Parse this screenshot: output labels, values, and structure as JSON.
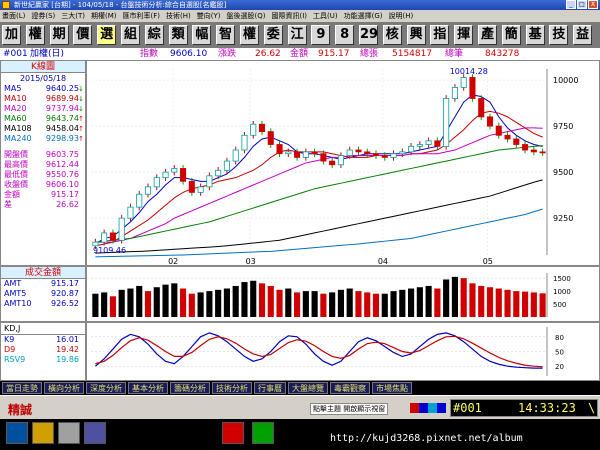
{
  "titlebar": {
    "title": "新世紀贏家 [台期] - 104/05/18 - 台盤技術分析:綜合自選股[名鑑股]",
    "buttons": [
      "_",
      "□",
      "X"
    ]
  },
  "menubar": {
    "items": [
      "畫面(L)",
      "證券(S)",
      "三大(T)",
      "期權(M)",
      "匯市利率(F)",
      "技術(H)",
      "雙向(Y)",
      "盤後選股(Q)",
      "國際資訊(I)",
      "工具(U)",
      "功能選擇(G)",
      "說明(H)"
    ]
  },
  "toolbar": {
    "buttons": [
      {
        "label": "加",
        "sel": false
      },
      {
        "label": "權",
        "sel": false
      },
      {
        "label": "期",
        "sel": false
      },
      {
        "label": "價",
        "sel": false
      },
      {
        "label": "選",
        "sel": true
      },
      {
        "label": "組",
        "sel": false
      },
      {
        "label": "綜",
        "sel": false
      },
      {
        "label": "類",
        "sel": false
      },
      {
        "label": "幅",
        "sel": false
      },
      {
        "label": "智",
        "sel": false
      },
      {
        "label": "權",
        "sel": false
      },
      {
        "label": "委",
        "sel": false
      },
      {
        "label": "江",
        "sel": false
      },
      {
        "label": "9",
        "sel": false
      },
      {
        "label": "8",
        "sel": false
      },
      {
        "label": "29",
        "sel": false
      },
      {
        "label": "核",
        "sel": false
      },
      {
        "label": "興",
        "sel": false
      },
      {
        "label": "指",
        "sel": false
      },
      {
        "label": "揮",
        "sel": false
      },
      {
        "label": "產",
        "sel": false
      },
      {
        "label": "簡",
        "sel": false
      },
      {
        "label": "基",
        "sel": false
      },
      {
        "label": "技",
        "sel": false
      },
      {
        "label": "益",
        "sel": false
      }
    ]
  },
  "info": {
    "code": "#001",
    "name": "加權(日)",
    "idx_label": "指數",
    "idx": "9606.10",
    "chg_label": "漲跌",
    "chg": "26.62",
    "amt_label": "金額",
    "amt": "915.17",
    "vol_label": "總張",
    "vol": "5154817",
    "cnt_label": "總筆",
    "cnt": "843278"
  },
  "leftpanel": {
    "title": "K線圖",
    "date": "2015/05/18",
    "ma": [
      {
        "k": "MA5",
        "v": "9640.25",
        "ar": "↓",
        "color": "#0000c0"
      },
      {
        "k": "MA10",
        "v": "9689.94",
        "ar": "↓",
        "color": "#c00000"
      },
      {
        "k": "MA20",
        "v": "9737.94",
        "ar": "↓",
        "color": "#c000c0"
      },
      {
        "k": "MA60",
        "v": "9643.74",
        "ar": "↑",
        "color": "#008000"
      },
      {
        "k": "MA108",
        "v": "9458.04",
        "ar": "↑",
        "color": "#000000"
      },
      {
        "k": "MA240",
        "v": "9298.93",
        "ar": "↑",
        "color": "#0070c0"
      }
    ],
    "quote": [
      {
        "k": "開盤價",
        "v": "9603.75",
        "color": "#c000c0"
      },
      {
        "k": "最高價",
        "v": "9612.44",
        "color": "#c000c0"
      },
      {
        "k": "最低價",
        "v": "9550.76",
        "color": "#c000c0"
      },
      {
        "k": "收盤價",
        "v": "9606.10",
        "color": "#c000c0"
      },
      {
        "k": "金額",
        "v": "915.17",
        "color": "#c000c0"
      },
      {
        "k": "差",
        "v": "26.62",
        "color": "#c000c0"
      }
    ]
  },
  "chart_data": [
    {
      "type": "line",
      "title": "K線圖",
      "x_ticks": [
        "02",
        "03",
        "04",
        "05"
      ],
      "y_ticks": [
        10000,
        9750,
        9500,
        9250
      ],
      "ylim": [
        9050,
        10060
      ],
      "annotations": {
        "high": "10014.28",
        "low": "9109.46"
      },
      "close": [
        9120,
        9170,
        9130,
        9250,
        9310,
        9380,
        9420,
        9470,
        9500,
        9520,
        9450,
        9390,
        9420,
        9480,
        9510,
        9560,
        9620,
        9700,
        9760,
        9720,
        9650,
        9600,
        9610,
        9580,
        9610,
        9600,
        9560,
        9540,
        9590,
        9620,
        9610,
        9600,
        9590,
        9580,
        9600,
        9610,
        9640,
        9650,
        9670,
        9640,
        9900,
        9960,
        10014,
        9900,
        9800,
        9750,
        9700,
        9680,
        9650,
        9620,
        9610,
        9606
      ],
      "series": [
        {
          "name": "MA5",
          "color": "#0000c0",
          "values": [
            9110,
            9140,
            9150,
            9190,
            9230,
            9280,
            9340,
            9380,
            9430,
            9470,
            9470,
            9460,
            9450,
            9450,
            9470,
            9490,
            9530,
            9580,
            9640,
            9680,
            9690,
            9670,
            9650,
            9610,
            9600,
            9600,
            9590,
            9580,
            9570,
            9580,
            9590,
            9600,
            9600,
            9600,
            9600,
            9600,
            9610,
            9620,
            9630,
            9640,
            9720,
            9800,
            9880,
            9920,
            9910,
            9880,
            9800,
            9740,
            9700,
            9670,
            9650,
            9640
          ]
        },
        {
          "name": "MA10",
          "color": "#c00000",
          "values": [
            9100,
            9110,
            9120,
            9150,
            9180,
            9210,
            9240,
            9280,
            9320,
            9360,
            9390,
            9410,
            9420,
            9430,
            9450,
            9460,
            9470,
            9490,
            9510,
            9540,
            9580,
            9610,
            9620,
            9610,
            9610,
            9610,
            9610,
            9600,
            9590,
            9580,
            9580,
            9580,
            9590,
            9590,
            9590,
            9590,
            9600,
            9600,
            9610,
            9620,
            9650,
            9690,
            9730,
            9780,
            9820,
            9830,
            9820,
            9800,
            9770,
            9740,
            9710,
            9690
          ]
        },
        {
          "name": "MA20",
          "color": "#c000c0",
          "values": [
            9120,
            9120,
            9120,
            9130,
            9140,
            9160,
            9180,
            9200,
            9220,
            9250,
            9270,
            9290,
            9310,
            9330,
            9350,
            9370,
            9390,
            9410,
            9430,
            9450,
            9470,
            9490,
            9510,
            9530,
            9550,
            9560,
            9570,
            9580,
            9580,
            9590,
            9590,
            9590,
            9590,
            9590,
            9590,
            9590,
            9600,
            9600,
            9600,
            9600,
            9610,
            9620,
            9640,
            9660,
            9680,
            9700,
            9710,
            9720,
            9730,
            9740,
            9740,
            9738
          ]
        },
        {
          "name": "MA60",
          "color": "#008000",
          "values": [
            9120,
            9125,
            9130,
            9135,
            9140,
            9150,
            9160,
            9170,
            9180,
            9190,
            9200,
            9210,
            9220,
            9230,
            9245,
            9260,
            9275,
            9290,
            9305,
            9320,
            9335,
            9350,
            9365,
            9380,
            9395,
            9410,
            9420,
            9430,
            9440,
            9450,
            9460,
            9470,
            9480,
            9490,
            9500,
            9510,
            9520,
            9530,
            9540,
            9550,
            9560,
            9570,
            9580,
            9590,
            9600,
            9610,
            9620,
            9625,
            9630,
            9635,
            9640,
            9644
          ]
        },
        {
          "name": "MA108",
          "color": "#000000",
          "values": [
            9060,
            9062,
            9064,
            9066,
            9068,
            9070,
            9072,
            9075,
            9078,
            9081,
            9084,
            9087,
            9090,
            9093,
            9096,
            9100,
            9105,
            9110,
            9115,
            9120,
            9125,
            9130,
            9140,
            9150,
            9160,
            9170,
            9180,
            9190,
            9200,
            9210,
            9220,
            9230,
            9240,
            9250,
            9260,
            9270,
            9280,
            9290,
            9300,
            9310,
            9320,
            9330,
            9340,
            9350,
            9360,
            9370,
            9385,
            9400,
            9415,
            9430,
            9445,
            9458
          ]
        },
        {
          "name": "MA240",
          "color": "#0070c0",
          "values": [
            9040,
            9041,
            9042,
            9043,
            9044,
            9045,
            9046,
            9047,
            9048,
            9049,
            9050,
            9052,
            9054,
            9056,
            9058,
            9060,
            9062,
            9064,
            9066,
            9068,
            9070,
            9074,
            9078,
            9082,
            9086,
            9090,
            9094,
            9098,
            9102,
            9106,
            9110,
            9115,
            9120,
            9125,
            9130,
            9135,
            9140,
            9150,
            9160,
            9170,
            9180,
            9190,
            9200,
            9210,
            9220,
            9230,
            9240,
            9250,
            9260,
            9270,
            9285,
            9299
          ]
        }
      ]
    },
    {
      "type": "bar",
      "title": "成交金額",
      "y_ticks": [
        1500,
        1000,
        500
      ],
      "ylim": [
        0,
        1700
      ],
      "values": [
        900,
        950,
        800,
        1050,
        1100,
        1200,
        1000,
        1150,
        1250,
        1300,
        1100,
        900,
        950,
        1000,
        1050,
        1100,
        1200,
        1350,
        1400,
        1300,
        1200,
        1050,
        1100,
        950,
        1000,
        1000,
        900,
        950,
        1050,
        1100,
        1000,
        950,
        900,
        900,
        1000,
        1050,
        1100,
        1150,
        1200,
        1100,
        1450,
        1550,
        1500,
        1300,
        1200,
        1150,
        1100,
        1050,
        1000,
        980,
        950,
        915
      ],
      "series": [
        {
          "name": "AMT",
          "value": "915.17"
        },
        {
          "name": "AMT5",
          "value": "920.87"
        },
        {
          "name": "AMT10",
          "value": "926.52"
        }
      ]
    },
    {
      "type": "line",
      "title": "KD,J",
      "y_ticks": [
        80,
        50,
        20
      ],
      "ylim": [
        0,
        100
      ],
      "series": [
        {
          "name": "K9",
          "value": "16.01",
          "color": "#0000c0",
          "values": [
            20,
            35,
            55,
            75,
            85,
            80,
            65,
            45,
            30,
            25,
            40,
            60,
            80,
            88,
            82,
            70,
            55,
            40,
            30,
            35,
            50,
            70,
            82,
            80,
            65,
            45,
            30,
            22,
            30,
            50,
            70,
            78,
            72,
            60,
            48,
            40,
            45,
            60,
            75,
            85,
            88,
            82,
            70,
            55,
            40,
            30,
            24,
            20,
            18,
            17,
            16,
            16
          ]
        },
        {
          "name": "D9",
          "value": "19.42",
          "color": "#c00000",
          "values": [
            25,
            30,
            42,
            58,
            72,
            78,
            73,
            62,
            50,
            40,
            40,
            48,
            62,
            75,
            80,
            76,
            67,
            55,
            45,
            40,
            44,
            56,
            68,
            74,
            71,
            62,
            50,
            40,
            36,
            42,
            55,
            66,
            69,
            66,
            58,
            50,
            47,
            52,
            62,
            72,
            80,
            81,
            76,
            67,
            57,
            47,
            38,
            31,
            26,
            22,
            20,
            19
          ]
        },
        {
          "name": "RSV9",
          "value": "19.86",
          "color": "#00a0c0",
          "values": []
        }
      ]
    }
  ],
  "tabs": [
    "當日走勢",
    "橫向分析",
    "深度分析",
    "基本分析",
    "籌碼分析",
    "技術分析",
    "行事曆",
    "大盤總覽",
    "毒霸觀察",
    "市場焦點"
  ],
  "status": {
    "left": "精誠",
    "center": "點擊主題 開啟顯示視窗",
    "code": "#001",
    "time": "14:33:23",
    "sep": "\\"
  },
  "taskbar": {
    "url": "http://kujd3268.pixnet.net/album"
  }
}
